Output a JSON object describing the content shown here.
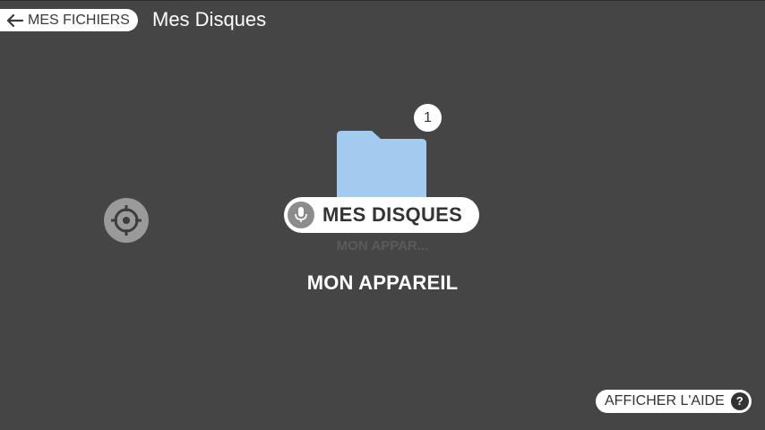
{
  "header": {
    "back_label": "MES FICHIERS",
    "title": "Mes Disques"
  },
  "main": {
    "folder_badge": "1",
    "focused_item_label": "MES DISQUES",
    "faded_item_label": "MON APPAR...",
    "item_label": "MON APPAREIL"
  },
  "footer": {
    "help_label": "AFFICHER L'AIDE",
    "help_icon_glyph": "?"
  },
  "icons": {
    "back": "arrow-left-icon",
    "crosshair": "crosshair-icon",
    "folder": "folder-icon",
    "mic": "microphone-icon",
    "help": "question-icon"
  },
  "colors": {
    "background": "#454545",
    "folder": "#a3cbef",
    "pill": "#ffffff"
  }
}
